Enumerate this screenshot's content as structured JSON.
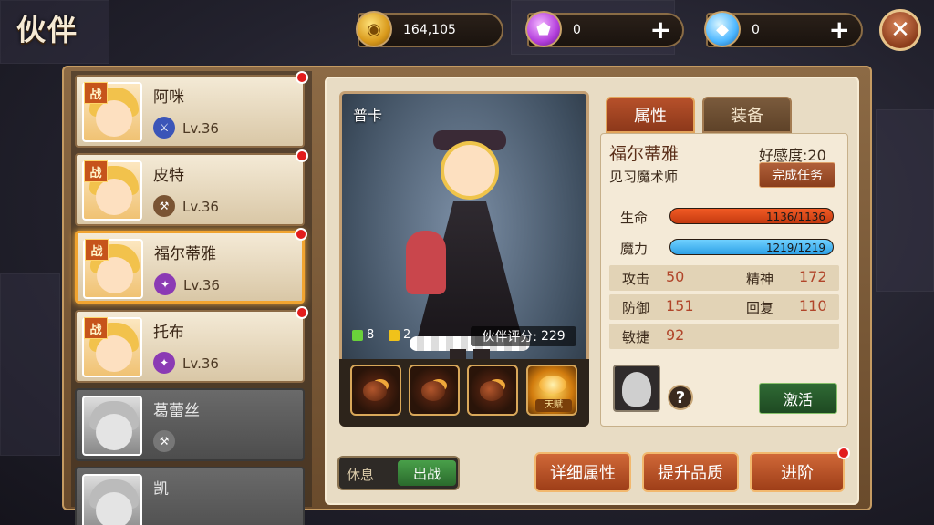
{
  "header": {
    "title": "伙伴",
    "gold": "164,105",
    "purple_gem": "0",
    "diamond": "0",
    "plus": "+",
    "close": "✕"
  },
  "partners": [
    {
      "name": "阿咪",
      "level": "Lv.36",
      "battle": "战",
      "class_icon": "sword-class-icon",
      "color": "#3b55b8"
    },
    {
      "name": "皮特",
      "level": "Lv.36",
      "battle": "战",
      "class_icon": "hammer-class-icon",
      "color": "#7a5433"
    },
    {
      "name": "福尔蒂雅",
      "level": "Lv.36",
      "battle": "战",
      "class_icon": "magic-class-icon",
      "color": "#8b3ab4"
    },
    {
      "name": "托布",
      "level": "Lv.36",
      "battle": "战",
      "class_icon": "magic-class-icon",
      "color": "#8b3ab4"
    },
    {
      "name": "葛蕾丝",
      "level": "",
      "battle": "",
      "class_icon": "hammer-class-icon",
      "color": "#777777"
    },
    {
      "name": "凯",
      "level": "",
      "battle": "",
      "class_icon": "",
      "color": "#777777"
    }
  ],
  "showcase": {
    "name": "普卡",
    "green_count": "8",
    "yellow_count": "2",
    "score_label": "伙伴评分:",
    "score": "229",
    "passive_label": "天赋"
  },
  "tabs": {
    "attributes": "属性",
    "equipment": "装备"
  },
  "info": {
    "name": "福尔蒂雅",
    "role": "见习魔术师",
    "favor_label": "好感度:",
    "favor": "20",
    "task_button": "完成任务",
    "hp_label": "生命",
    "hp": "1136/1136",
    "hp_ratio": 1.0,
    "mp_label": "魔力",
    "mp": "1219/1219",
    "mp_ratio": 1.0,
    "attack_label": "攻击",
    "attack": "50",
    "spirit_label": "精神",
    "spirit": "172",
    "defense_label": "防御",
    "defense": "151",
    "recover_label": "回复",
    "recover": "110",
    "agility_label": "敏捷",
    "agility": "92",
    "help": "?",
    "activate_button": "激活"
  },
  "bottom": {
    "rest": "休息",
    "fight": "出战",
    "detail_button": "详细属性",
    "quality_button": "提升品质",
    "advance_button": "进阶"
  },
  "colors": {
    "hp": "#f15a24",
    "mp": "#2ea0e6",
    "accent": "#c6541b"
  }
}
